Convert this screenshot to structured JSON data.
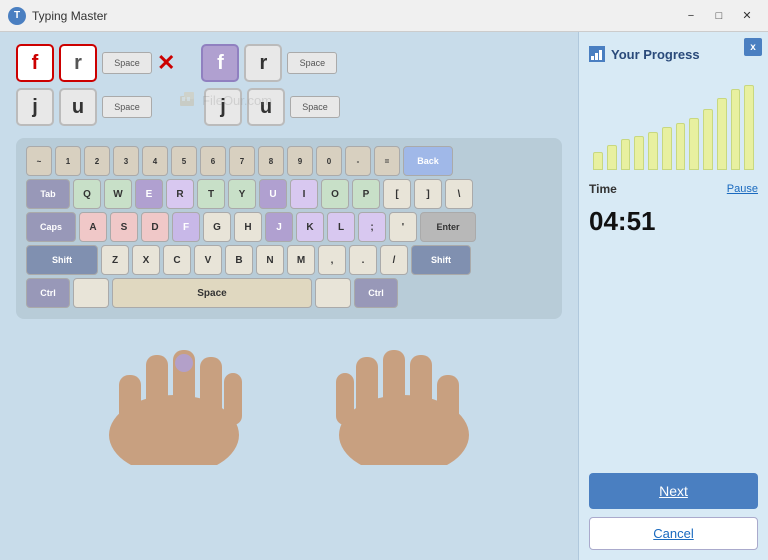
{
  "titlebar": {
    "title": "Typing Master",
    "minimize_label": "−",
    "maximize_label": "□",
    "close_label": "✕"
  },
  "sequence": {
    "row1": {
      "key1": "f",
      "key2": "r",
      "space_label": "Space",
      "error": "✕",
      "key3": "f",
      "key4": "r",
      "space2_label": "Space"
    },
    "row2": {
      "key1": "j",
      "key2": "u",
      "space_label": "Space",
      "key3": "j",
      "key4": "u",
      "space2_label": "Space"
    }
  },
  "watermark": "FileOur.com",
  "keyboard": {
    "rows": [
      [
        "~",
        "1",
        "2",
        "3",
        "4",
        "5",
        "6",
        "7",
        "8",
        "9",
        "0",
        "-",
        "=",
        "Back"
      ],
      [
        "Tab",
        "Q",
        "W",
        "E",
        "R",
        "T",
        "Y",
        "U",
        "I",
        "O",
        "P",
        "[",
        "]",
        "\\"
      ],
      [
        "Caps",
        "A",
        "S",
        "D",
        "F",
        "G",
        "H",
        "J",
        "K",
        "L",
        ";",
        "'",
        "Enter"
      ],
      [
        "Shift",
        "Z",
        "X",
        "C",
        "V",
        "B",
        "N",
        "M",
        ",",
        ".",
        "/",
        "Shift"
      ],
      [
        "Ctrl",
        "",
        "Space",
        "",
        "Ctrl"
      ]
    ]
  },
  "progress": {
    "title": "Your Progress",
    "close_label": "x",
    "chart_bars": [
      20,
      28,
      35,
      38,
      42,
      48,
      52,
      58,
      68,
      80,
      90,
      95
    ],
    "time_label": "Time",
    "pause_label": "Pause",
    "time_value": "04:51"
  },
  "buttons": {
    "next_label": "Next",
    "cancel_label": "Cancel"
  }
}
